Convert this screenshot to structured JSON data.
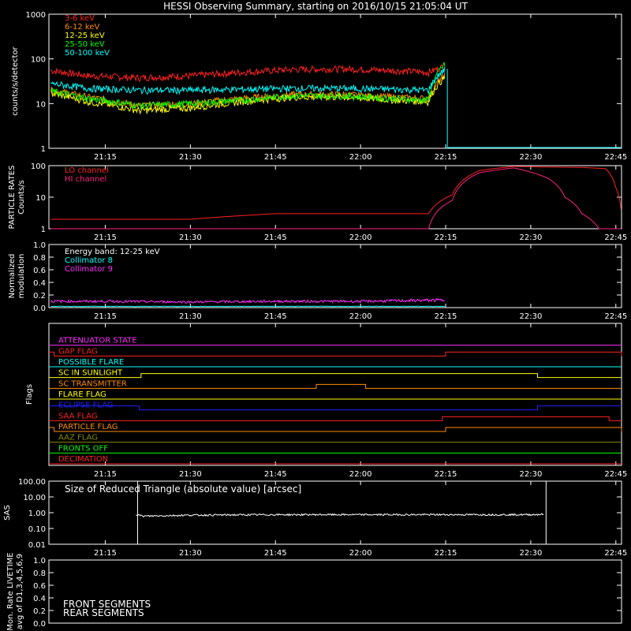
{
  "title": "HESSI Observing Summary, starting on 2016/10/15 21:05:04 UT",
  "time_ticks": [
    "21:15",
    "21:30",
    "21:45",
    "22:00",
    "22:15",
    "22:30",
    "22:45"
  ],
  "time_tick_hours": [
    21.25,
    21.5,
    21.75,
    22.0,
    22.25,
    22.5,
    22.75
  ],
  "time_range": [
    21.0844,
    22.7667
  ],
  "chart_data": [
    {
      "type": "line",
      "panel": "countrates",
      "ylabel": "counts/s/detector",
      "yscale": "log",
      "ylim": [
        1,
        1000
      ],
      "ytick_labels": [
        "1",
        "10",
        "100",
        "1000"
      ],
      "legend_placement": "top-left",
      "series": [
        {
          "name": "3-6 keV",
          "color": "#ff2020",
          "x": [
            21.09,
            21.2,
            21.35,
            21.5,
            21.65,
            21.8,
            21.95,
            22.1,
            22.2,
            22.25
          ],
          "y": [
            55,
            42,
            38,
            42,
            50,
            58,
            60,
            55,
            50,
            70
          ]
        },
        {
          "name": "6-12 keV",
          "color": "#ff8c00",
          "x": [
            21.09,
            21.2,
            21.35,
            21.5,
            21.65,
            21.8,
            21.95,
            22.1,
            22.2,
            22.25
          ],
          "y": [
            20,
            14,
            9,
            10,
            13,
            16,
            16,
            14,
            13,
            45
          ]
        },
        {
          "name": "12-25 keV",
          "color": "#ffff00",
          "x": [
            21.09,
            21.2,
            21.35,
            21.5,
            21.65,
            21.8,
            21.95,
            22.1,
            22.2,
            22.25
          ],
          "y": [
            17,
            11,
            7,
            8,
            11,
            14,
            14,
            12,
            11,
            40
          ]
        },
        {
          "name": "25-50 keV",
          "color": "#00ff00",
          "x": [
            21.09,
            21.2,
            21.35,
            21.5,
            21.65,
            21.8,
            21.95,
            22.1,
            22.2,
            22.25
          ],
          "y": [
            19,
            13,
            9,
            10,
            12,
            15,
            15,
            13,
            12,
            80
          ]
        },
        {
          "name": "50-100 keV",
          "color": "#00ffff",
          "x": [
            21.09,
            21.2,
            21.35,
            21.5,
            21.65,
            21.8,
            21.95,
            22.1,
            22.2,
            22.25
          ],
          "y": [
            28,
            22,
            20,
            20,
            21,
            22,
            22,
            21,
            20,
            60
          ]
        }
      ]
    },
    {
      "type": "line",
      "panel": "particles",
      "ylabel": "PARTICLE RATES Counts/s",
      "yscale": "log",
      "ylim": [
        1,
        100
      ],
      "ytick_labels": [
        "1",
        "10",
        "100"
      ],
      "legend_placement": "top-left",
      "series": [
        {
          "name": "LO channel",
          "color": "#ff2020",
          "x": [
            21.09,
            21.5,
            21.75,
            22.0,
            22.2,
            22.27,
            22.35,
            22.45,
            22.55,
            22.65,
            22.72,
            22.75,
            22.767
          ],
          "y": [
            2,
            2,
            3,
            3,
            3,
            12,
            70,
            95,
            90,
            88,
            80,
            20,
            2
          ]
        },
        {
          "name": "HI channel",
          "color": "#ff2080",
          "x": [
            21.09,
            21.5,
            22.0,
            22.2,
            22.27,
            22.35,
            22.45,
            22.55,
            22.6,
            22.65,
            22.7,
            22.767
          ],
          "y": [
            1,
            1,
            1,
            1,
            8,
            60,
            85,
            40,
            10,
            3,
            1,
            1
          ]
        }
      ]
    },
    {
      "type": "line",
      "panel": "modulation",
      "ylabel": "Normalized modulation",
      "ylim": [
        0,
        1
      ],
      "ytick_labels": [
        "0.0",
        "0.2",
        "0.4",
        "0.6",
        "0.8",
        "1.0"
      ],
      "annotation": "Energy band: 12-25 keV",
      "series": [
        {
          "name": "Collimator 8",
          "color": "#00ffff",
          "x": [
            21.09,
            22.25
          ],
          "y": [
            0.02,
            0.02
          ]
        },
        {
          "name": "Collimator 9",
          "color": "#ff30ff",
          "x": [
            21.09,
            21.25,
            21.5,
            21.75,
            22.0,
            22.25
          ],
          "y": [
            0.1,
            0.1,
            0.09,
            0.1,
            0.1,
            0.12
          ]
        }
      ]
    },
    {
      "type": "line",
      "panel": "sas",
      "ylabel": "SAS",
      "yscale": "log",
      "ylim": [
        0.01,
        100
      ],
      "ytick_labels": [
        "0.01",
        "0.10",
        "1.00",
        "10.00",
        "100.00"
      ],
      "annotation": "Size of Reduced Triangle (absolute value) [arcsec]",
      "series": [
        {
          "color": "#ffffff",
          "x": [
            21.34,
            21.36,
            21.5,
            21.75,
            22.0,
            22.25,
            22.5,
            22.54
          ],
          "y": [
            0.8,
            0.6,
            0.7,
            0.75,
            0.75,
            0.75,
            0.75,
            0.8
          ]
        }
      ]
    },
    {
      "type": "line",
      "panel": "livetime",
      "ylabel": "Mon. Rate LIVETIME avg of D1,3,4,5,6,9",
      "ylim": [
        0,
        1
      ],
      "ytick_labels": [
        "0.0",
        "0.2",
        "0.4",
        "0.6",
        "0.8",
        "1.0"
      ],
      "legend": [
        "FRONT SEGMENTS",
        "REAR SEGMENTS"
      ],
      "legend_colors": [
        "#00ff00",
        "#00aa00"
      ]
    }
  ],
  "flags_panel": {
    "ylabel": "Flags",
    "flags": [
      {
        "label": "ATTENUATOR STATE",
        "color": "#ff30ff",
        "steps": [
          [
            21.0844,
            0
          ]
        ]
      },
      {
        "label": "GAP FLAG",
        "color": "#ff2020",
        "steps": [
          [
            21.0844,
            1
          ],
          [
            21.1,
            0
          ],
          [
            22.25,
            1
          ],
          [
            22.767,
            0
          ]
        ]
      },
      {
        "label": "POSSIBLE FLARE",
        "color": "#00ffff",
        "steps": [
          [
            21.0844,
            0
          ]
        ]
      },
      {
        "label": "SC IN SUNLIGHT",
        "color": "#ffff00",
        "steps": [
          [
            21.0844,
            0
          ],
          [
            21.355,
            1
          ],
          [
            22.52,
            0
          ]
        ]
      },
      {
        "label": "SC TRANSMITTER",
        "color": "#ff8c00",
        "steps": [
          [
            21.0844,
            0
          ],
          [
            21.87,
            1
          ],
          [
            22.015,
            0
          ]
        ]
      },
      {
        "label": "FLARE FLAG",
        "color": "#ffff00",
        "steps": [
          [
            21.0844,
            0
          ]
        ]
      },
      {
        "label": "ECLIPSE FLAG",
        "color": "#2020ff",
        "steps": [
          [
            21.0844,
            1
          ],
          [
            21.35,
            0
          ],
          [
            22.52,
            1
          ]
        ]
      },
      {
        "label": "SAA FLAG",
        "color": "#ff2020",
        "steps": [
          [
            21.0844,
            0
          ],
          [
            22.24,
            1
          ],
          [
            22.73,
            0
          ]
        ]
      },
      {
        "label": "PARTICLE FLAG",
        "color": "#ff8c00",
        "steps": [
          [
            21.0844,
            1
          ],
          [
            21.1,
            0
          ],
          [
            22.25,
            1
          ],
          [
            22.767,
            0
          ]
        ]
      },
      {
        "label": "AAZ FLAG",
        "color": "#888800",
        "steps": [
          [
            21.0844,
            0
          ]
        ]
      },
      {
        "label": "FRONTS OFF",
        "color": "#00ff00",
        "steps": [
          [
            21.0844,
            0
          ]
        ]
      },
      {
        "label": "DECIMATION",
        "color": "#ff2020",
        "steps": [
          [
            21.0844,
            0
          ]
        ]
      }
    ]
  }
}
